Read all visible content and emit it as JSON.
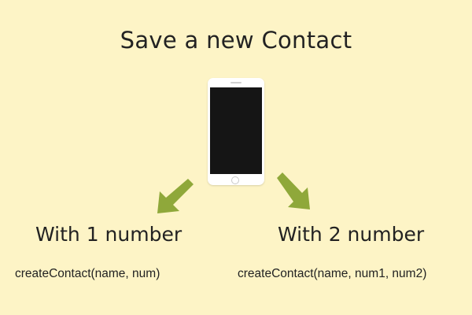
{
  "background_color": "#fdf4c6",
  "arrow_color": "#8fa83a",
  "title": "Save a new Contact",
  "phone": {
    "icon": "smartphone-icon",
    "body_color": "#ffffff",
    "screen_color": "#151515"
  },
  "branches": [
    {
      "label": "With 1 number",
      "code": "createContact(name, num)",
      "arrow_icon": "arrow-down-left-icon"
    },
    {
      "label": "With 2 number",
      "code": "createContact(name, num1, num2)",
      "arrow_icon": "arrow-down-right-icon"
    }
  ]
}
